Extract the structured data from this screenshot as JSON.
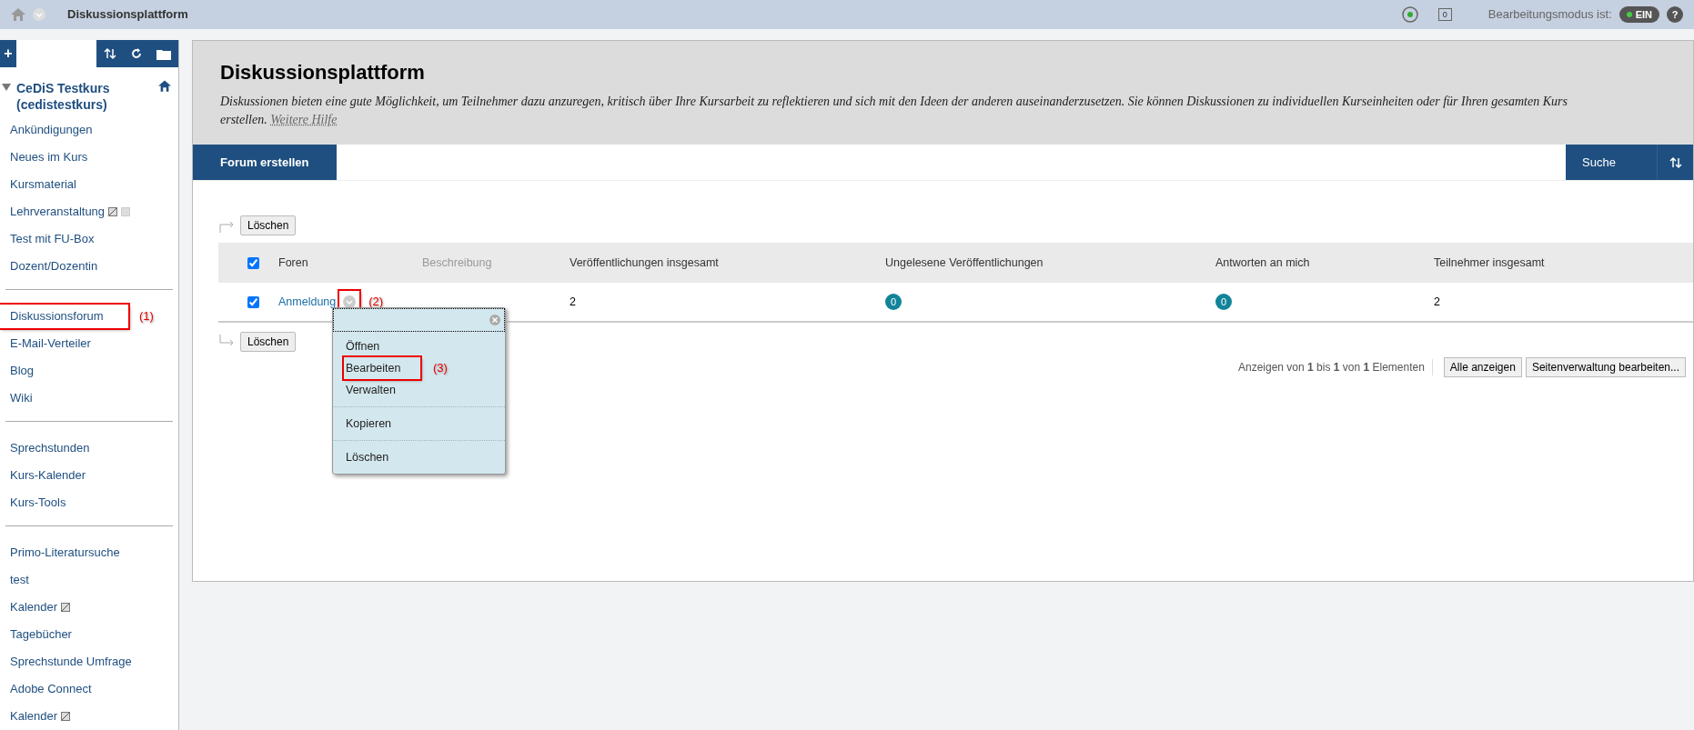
{
  "topbar": {
    "title": "Diskussionsplattform",
    "notification_count": "0",
    "edit_mode_label": "Bearbeitungsmodus ist:",
    "edit_mode": {
      "label": "EIN",
      "on": true
    },
    "help": "?"
  },
  "sidebar": {
    "add_button": "+",
    "course_title": "CeDiS Testkurs (cedistestkurs)",
    "groups": [
      {
        "items": [
          {
            "label": "Ankündigungen",
            "highlighted": false
          },
          {
            "label": "Neues im Kurs",
            "highlighted": false
          },
          {
            "label": "Kursmaterial",
            "highlighted": false
          },
          {
            "label": "Lehrveranstaltung",
            "slashed_icon": true,
            "dotted_icon": true,
            "highlighted": false
          },
          {
            "label": "Test mit FU-Box",
            "highlighted": false
          },
          {
            "label": "Dozent/Dozentin",
            "highlighted": false
          }
        ]
      },
      {
        "items": [
          {
            "label": "Diskussionsforum",
            "highlighted": true,
            "annotation": "(1)"
          },
          {
            "label": "E-Mail-Verteiler",
            "highlighted": false
          },
          {
            "label": "Blog",
            "highlighted": false
          },
          {
            "label": "Wiki",
            "highlighted": false
          }
        ]
      },
      {
        "items": [
          {
            "label": "Sprechstunden",
            "highlighted": false
          },
          {
            "label": "Kurs-Kalender",
            "highlighted": false
          },
          {
            "label": "Kurs-Tools",
            "highlighted": false
          }
        ]
      },
      {
        "items": [
          {
            "label": "Primo-Literatursuche",
            "highlighted": false
          },
          {
            "label": "test",
            "highlighted": false
          },
          {
            "label": "Kalender",
            "slashed_icon": true,
            "highlighted": false
          },
          {
            "label": "Tagebücher",
            "highlighted": false
          },
          {
            "label": "Sprechstunde Umfrage",
            "highlighted": false
          },
          {
            "label": "Adobe Connect",
            "highlighted": false
          },
          {
            "label": "Kalender",
            "slashed_icon": true,
            "highlighted": false
          }
        ]
      }
    ]
  },
  "page": {
    "title": "Diskussionsplattform",
    "description": "Diskussionen bieten eine gute Möglichkeit, um Teilnehmer dazu anzuregen, kritisch über Ihre Kursarbeit zu reflektieren und sich mit den Ideen der anderen auseinanderzusetzen. Sie können Diskussionen zu individuellen Kurseinheiten oder für Ihren gesamten Kurs erstellen.",
    "help_link": "Weitere Hilfe"
  },
  "actionbar": {
    "create_button": "Forum erstellen",
    "search_button": "Suche"
  },
  "table": {
    "delete_button_top": "Löschen",
    "delete_button_bottom": "Löschen",
    "header_checked": true,
    "columns": [
      {
        "label": "Foren",
        "muted": false
      },
      {
        "label": "Beschreibung",
        "muted": true
      },
      {
        "label": "Veröffentlichungen insgesamt",
        "muted": false
      },
      {
        "label": "Ungelesene Veröffentlichungen",
        "muted": false
      },
      {
        "label": "Antworten an mich",
        "muted": false
      },
      {
        "label": "Teilnehmer insgesamt",
        "muted": false
      }
    ],
    "rows": [
      {
        "checked": true,
        "name": "Anmeldung",
        "annotation": "(2)",
        "posts": "2",
        "unread": "0",
        "replies": "0",
        "participants": "2"
      }
    ]
  },
  "context_menu": {
    "open": true,
    "groups": [
      [
        {
          "label": "Öffnen",
          "highlighted": false
        },
        {
          "label": "Bearbeiten",
          "highlighted": true,
          "annotation": "(3)"
        },
        {
          "label": "Verwalten",
          "highlighted": false
        }
      ],
      [
        {
          "label": "Kopieren",
          "highlighted": false
        }
      ],
      [
        {
          "label": "Löschen",
          "highlighted": false
        }
      ]
    ]
  },
  "pagination": {
    "summary": "Anzeigen von **1** bis **1** von **1** Elementen",
    "show_all_button": "Alle anzeigen",
    "edit_paging_button": "Seitenverwaltung bearbeiten..."
  }
}
